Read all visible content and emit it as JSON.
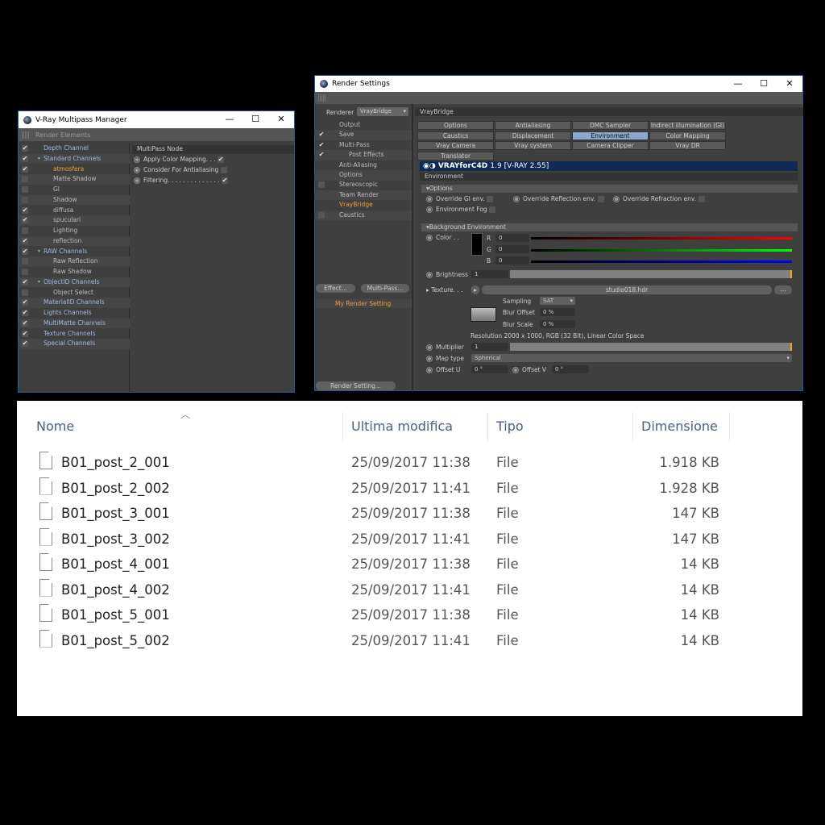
{
  "multipass": {
    "title": "V-Ray Multipass Manager",
    "toolbar": "Render Elements",
    "tree": [
      {
        "label": "Depth Channel",
        "checked": true,
        "level": 0
      },
      {
        "label": "Standard Channels",
        "checked": true,
        "level": 0,
        "expanded": true
      },
      {
        "label": "atmosfera",
        "checked": true,
        "level": 1,
        "selected": true
      },
      {
        "label": "Matte Shadow",
        "checked": false,
        "level": 1
      },
      {
        "label": "GI",
        "checked": false,
        "level": 1
      },
      {
        "label": "Shadow",
        "checked": false,
        "level": 1
      },
      {
        "label": "diffusa",
        "checked": true,
        "level": 1
      },
      {
        "label": "spuculari",
        "checked": true,
        "level": 1
      },
      {
        "label": "Lighting",
        "checked": false,
        "level": 1
      },
      {
        "label": "reflection",
        "checked": true,
        "level": 1
      },
      {
        "label": "RAW Channels",
        "checked": true,
        "level": 0,
        "expanded": true
      },
      {
        "label": "Raw Reflection",
        "checked": false,
        "level": 1
      },
      {
        "label": "Raw Shadow",
        "checked": false,
        "level": 1
      },
      {
        "label": "ObjectID Channels",
        "checked": true,
        "level": 0,
        "expanded": true
      },
      {
        "label": "Object Select",
        "checked": false,
        "level": 1
      },
      {
        "label": "MaterialID Channels",
        "checked": true,
        "level": 0
      },
      {
        "label": "Lights Channels",
        "checked": true,
        "level": 0
      },
      {
        "label": "MultiMatte Channels",
        "checked": true,
        "level": 0
      },
      {
        "label": "Texture Channels",
        "checked": true,
        "level": 0
      },
      {
        "label": "Special Channels",
        "checked": true,
        "level": 0
      }
    ],
    "node_header": "MultiPass Node",
    "options": [
      {
        "label": "Apply Color Mapping. . .",
        "checked": true
      },
      {
        "label": "Consider For Antialiasing",
        "checked": false
      },
      {
        "label": "Filtering. . . . . . . . . . . . . .",
        "checked": true
      }
    ]
  },
  "render": {
    "title": "Render Settings",
    "renderer_label": "Renderer",
    "renderer_value": "VrayBridge",
    "tree": [
      {
        "label": "Output",
        "check": "none"
      },
      {
        "label": "Save",
        "check": "on"
      },
      {
        "label": "Multi-Pass",
        "check": "on"
      },
      {
        "label": "Post Effects",
        "check": "on",
        "level": 1
      },
      {
        "label": "Anti-Aliasing",
        "check": "none"
      },
      {
        "label": "Options",
        "check": "none"
      },
      {
        "label": "Stereoscopic",
        "check": "off"
      },
      {
        "label": "Team Render",
        "check": "none"
      },
      {
        "label": "VrayBridge",
        "check": "none",
        "selected": true
      },
      {
        "label": "Caustics",
        "check": "off"
      }
    ],
    "effect_btn": "Effect...",
    "multipass_btn": "Multi-Pass...",
    "setting_name": "My Render Setting",
    "render_setting_btn": "Render Setting...",
    "panel_header": "VrayBridge",
    "tabs": [
      "Options",
      "Antialiasing",
      "DMC Sampler",
      "Indirect illumination (GI)",
      "Caustics",
      "Displacement",
      "Environment",
      "Color Mapping",
      "Vray Camera",
      "Vray system",
      "Camera Clipper",
      "Vray DR",
      "Translator"
    ],
    "active_tab": "Environment",
    "banner_logo": "VRAYforC4D",
    "banner_version": "1.9  [V-RAY 2.55]",
    "env_header": "Environment",
    "options_header": "Options",
    "env_options": [
      "Override GI env.",
      "Override Reflection env.",
      "Override Refraction env.",
      "Environment Fog"
    ],
    "bg_header": "Background Environment",
    "color_label": "Color . .",
    "r": "0",
    "g": "0",
    "b": "0",
    "brightness_label": "Brightness",
    "brightness": "1",
    "texture_label": "Texture. . .",
    "texture_file": "studio018.hdr",
    "browse": "...",
    "sampling_label": "Sampling",
    "sampling": "SAT",
    "blur_offset_label": "Blur Offset",
    "blur_offset": "0 %",
    "blur_scale_label": "Blur Scale",
    "blur_scale": "0 %",
    "resolution": "Resolution 2000 x 1000, RGB (32 Bit), Linear Color Space",
    "multiplier_label": "Multiplier",
    "multiplier": "1",
    "maptype_label": "Map type",
    "maptype": "Spherical",
    "offset_u_label": "Offset U",
    "offset_u": "0 °",
    "offset_v_label": "Offset V",
    "offset_v": "0 °"
  },
  "explorer": {
    "columns": [
      "Nome",
      "Ultima modifica",
      "Tipo",
      "Dimensione"
    ],
    "files": [
      {
        "name": "B01_post_2_001",
        "date": "25/09/2017 11:38",
        "type": "File",
        "size": "1.918 KB"
      },
      {
        "name": "B01_post_2_002",
        "date": "25/09/2017 11:41",
        "type": "File",
        "size": "1.928 KB"
      },
      {
        "name": "B01_post_3_001",
        "date": "25/09/2017 11:38",
        "type": "File",
        "size": "147 KB"
      },
      {
        "name": "B01_post_3_002",
        "date": "25/09/2017 11:41",
        "type": "File",
        "size": "147 KB"
      },
      {
        "name": "B01_post_4_001",
        "date": "25/09/2017 11:38",
        "type": "File",
        "size": "14 KB"
      },
      {
        "name": "B01_post_4_002",
        "date": "25/09/2017 11:41",
        "type": "File",
        "size": "14 KB"
      },
      {
        "name": "B01_post_5_001",
        "date": "25/09/2017 11:38",
        "type": "File",
        "size": "14 KB"
      },
      {
        "name": "B01_post_5_002",
        "date": "25/09/2017 11:41",
        "type": "File",
        "size": "14 KB"
      }
    ]
  }
}
